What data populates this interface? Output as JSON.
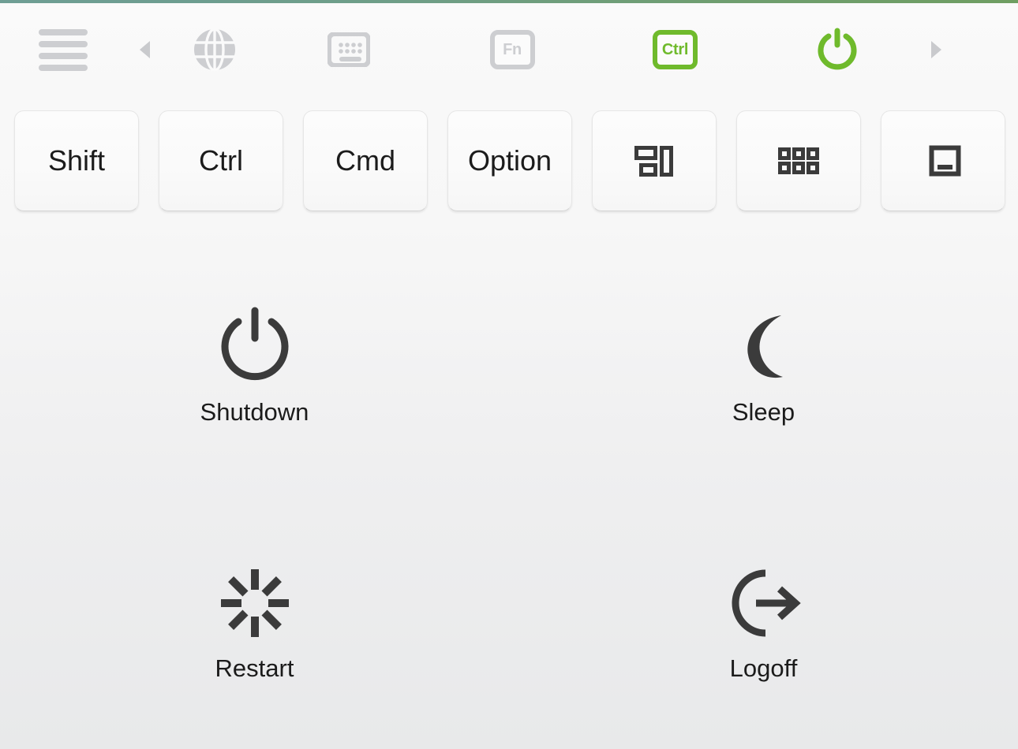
{
  "window": {
    "app_kind": "remote-control-keyboard-panel",
    "accent_color": "#6fba2c",
    "top_accent_color": "#6f9e86",
    "background_top": "#f9f9f9",
    "background_bottom": "#e8e9ea",
    "icon_gray": "#cdced1",
    "text_color": "#1b1b1b"
  },
  "toolbar": {
    "items": [
      {
        "name": "menu-icon",
        "label": "Menu",
        "icon": "hamburger-icon",
        "state": "idle"
      },
      {
        "name": "prev-page-arrow",
        "label": "Previous",
        "icon": "triangle-left-icon",
        "state": "idle"
      },
      {
        "name": "globe-tab",
        "label": "Globe",
        "icon": "globe-icon",
        "state": "idle"
      },
      {
        "name": "keyboard-tab",
        "label": "Keyboard",
        "icon": "keyboard-icon",
        "state": "idle"
      },
      {
        "name": "fn-tab",
        "label": "Fn",
        "icon": "fn-key-icon",
        "state": "idle"
      },
      {
        "name": "ctrl-tab",
        "label": "Ctrl",
        "icon": "ctrl-key-icon",
        "state": "active"
      },
      {
        "name": "power-tab",
        "label": "Power",
        "icon": "power-icon",
        "state": "active"
      },
      {
        "name": "next-page-arrow",
        "label": "Next",
        "icon": "triangle-right-icon",
        "state": "idle"
      }
    ],
    "fn_label": "Fn",
    "ctrl_label": "Ctrl"
  },
  "modifier_keys": [
    {
      "label": "Shift",
      "type": "text",
      "name": "key-shift"
    },
    {
      "label": "Ctrl",
      "type": "text",
      "name": "key-ctrl"
    },
    {
      "label": "Cmd",
      "type": "text",
      "name": "key-cmd"
    },
    {
      "label": "Option",
      "type": "text",
      "name": "key-option"
    },
    {
      "label": "",
      "type": "icon",
      "icon": "window-tile-icon",
      "name": "key-window-tile"
    },
    {
      "label": "",
      "type": "icon",
      "icon": "app-grid-icon",
      "name": "key-app-grid"
    },
    {
      "label": "",
      "type": "icon",
      "icon": "minimize-window-icon",
      "name": "key-minimize-window"
    }
  ],
  "power_actions": [
    {
      "label": "Shutdown",
      "icon": "power-icon",
      "name": "action-shutdown"
    },
    {
      "label": "Sleep",
      "icon": "moon-icon",
      "name": "action-sleep"
    },
    {
      "label": "Restart",
      "icon": "restart-burst-icon",
      "name": "action-restart"
    },
    {
      "label": "Logoff",
      "icon": "logoff-arrow-icon",
      "name": "action-logoff"
    }
  ]
}
